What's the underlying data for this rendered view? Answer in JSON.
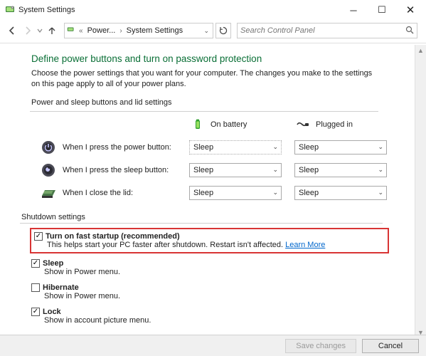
{
  "titlebar": {
    "title": "System Settings"
  },
  "navbar": {
    "crumb_prev": "Power...",
    "crumb_current": "System Settings",
    "search_placeholder": "Search Control Panel"
  },
  "main": {
    "heading": "Define power buttons and turn on password protection",
    "description": "Choose the power settings that you want for your computer. The changes you make to the settings on this page apply to all of your power plans.",
    "section1_title": "Power and sleep buttons and lid settings",
    "columns": {
      "battery": "On battery",
      "plugged": "Plugged in"
    },
    "rows": [
      {
        "label": "When I press the power button:",
        "battery": "Sleep",
        "plugged": "Sleep"
      },
      {
        "label": "When I press the sleep button:",
        "battery": "Sleep",
        "plugged": "Sleep"
      },
      {
        "label": "When I close the lid:",
        "battery": "Sleep",
        "plugged": "Sleep"
      }
    ],
    "shutdown_title": "Shutdown settings",
    "shutdown": [
      {
        "checked": true,
        "label": "Turn on fast startup (recommended)",
        "desc": "This helps start your PC faster after shutdown. Restart isn't affected.",
        "link": "Learn More"
      },
      {
        "checked": true,
        "label": "Sleep",
        "desc": "Show in Power menu."
      },
      {
        "checked": false,
        "label": "Hibernate",
        "desc": "Show in Power menu."
      },
      {
        "checked": true,
        "label": "Lock",
        "desc": "Show in account picture menu."
      }
    ]
  },
  "footer": {
    "save": "Save changes",
    "cancel": "Cancel"
  }
}
